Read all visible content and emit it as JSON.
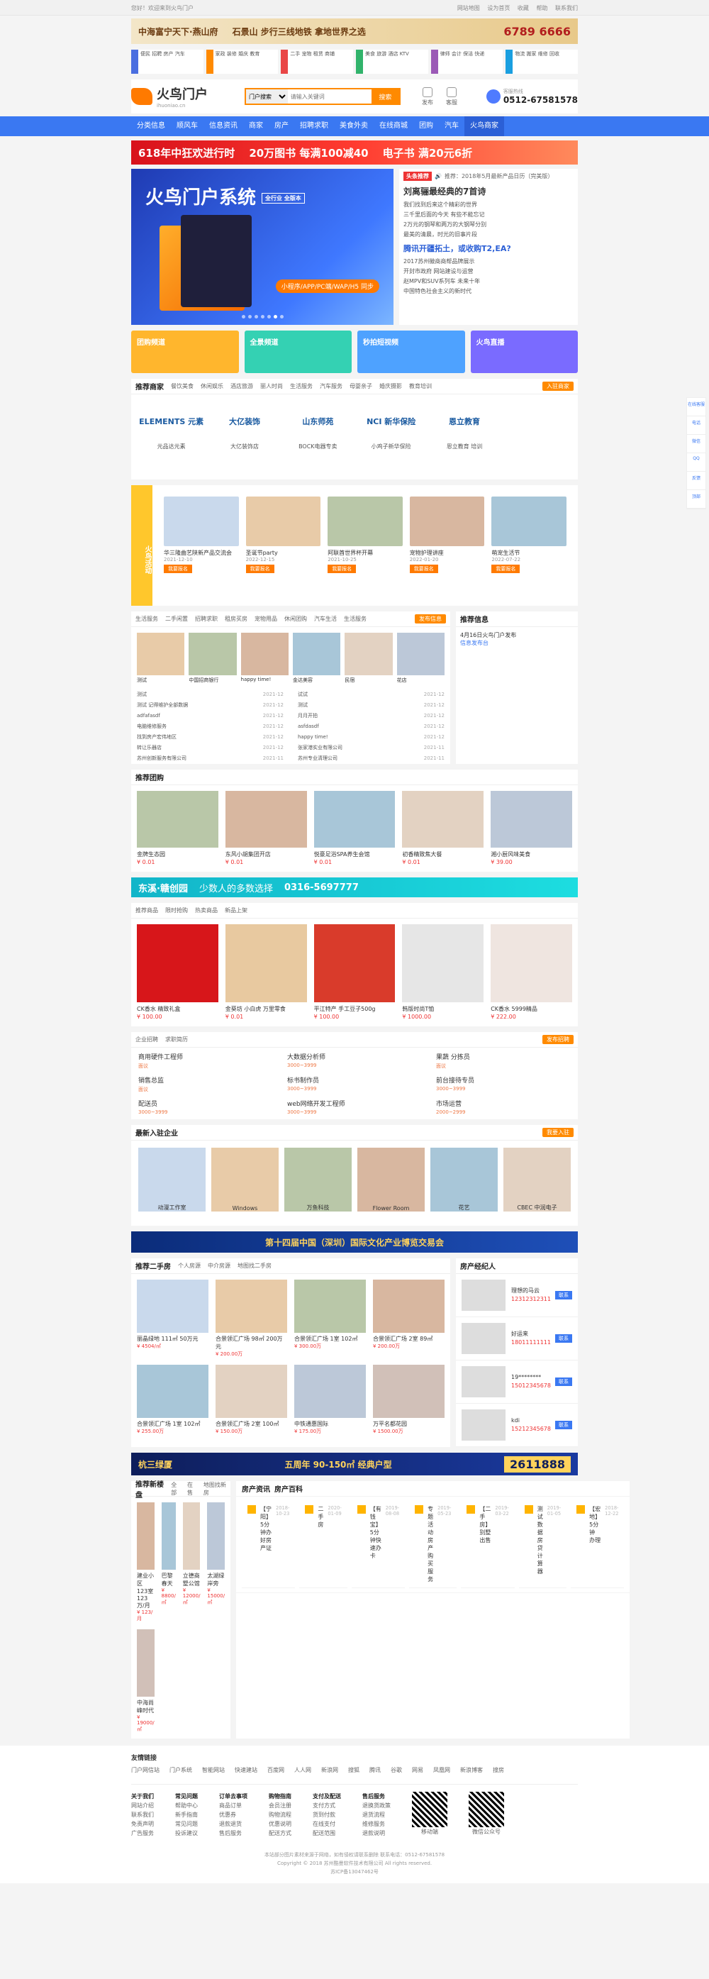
{
  "topbar": {
    "left": "您好！欢迎来到火鸟门户",
    "links": [
      "网站地图",
      "设为首页",
      "收藏",
      "帮助",
      "联系我们"
    ]
  },
  "ad_top": {
    "brand": "中海富宁天下·燕山府",
    "slogan": "石景山 步行三线地铁 拿地世界之选",
    "phone": "6789 6666"
  },
  "categories": [
    {
      "color": "#4a6ee0",
      "items": [
        "便民",
        "招聘",
        "房产",
        "汽车"
      ]
    },
    {
      "color": "#ff8a00",
      "items": [
        "家政",
        "装修",
        "婚庆",
        "教育"
      ]
    },
    {
      "color": "#e94646",
      "items": [
        "二手",
        "宠物",
        "租赁",
        "商铺"
      ]
    },
    {
      "color": "#31b36b",
      "items": [
        "美食",
        "旅游",
        "酒店",
        "KTV"
      ]
    },
    {
      "color": "#9b59b6",
      "items": [
        "律师",
        "会计",
        "保洁",
        "快递"
      ]
    },
    {
      "color": "#1a9fe0",
      "items": [
        "物流",
        "搬家",
        "维修",
        "回收"
      ]
    }
  ],
  "logo": {
    "name": "火鸟门户",
    "sub": "ihuoniao.cn"
  },
  "search": {
    "scope": "门户搜索",
    "placeholder": "请输入关键词",
    "button": "搜索"
  },
  "header_icons": [
    "发布",
    "客服"
  ],
  "hotline": {
    "label": "客服热线",
    "number": "0512-67581578"
  },
  "nav": [
    "分类信息",
    "顺风车",
    "信息资讯",
    "商家",
    "房产",
    "招聘求职",
    "美食外卖",
    "在线商城",
    "团购",
    "汽车",
    "火鸟商家"
  ],
  "ad618": {
    "left": "618年中狂欢进行时",
    "mid": "20万图书 每满100减40",
    "right": "电子书 满20元6折"
  },
  "banner": {
    "title": "火鸟门户系统",
    "tag": "全行业 全版本",
    "pill": "小程序/APP/PC端/WAP/H5 同步"
  },
  "news": {
    "badge": "头条推荐",
    "ticker": "推荐：2018年5月最新产品日历（完美版）",
    "headline": "刘离骊最经典的7首诗",
    "list1": [
      "我们找到后来这个精彩的世界",
      "三千里后面的今天 有些不能忘记",
      "2万元的钢琴和两万的大钢琴分别",
      "最美的清晨，时光的旧事片段"
    ],
    "headline2": "腾讯开疆拓土，或收购T2,EA?",
    "list2": [
      "2017苏州徽商商帮品牌展示",
      "开封市政府 网站建设与运营",
      "赵MPV和SUV系列车 未来十年",
      "中国特色社会主义的新时代"
    ]
  },
  "tiles": [
    {
      "label": "团购频道",
      "color": "#ffb62d"
    },
    {
      "label": "全景频道",
      "color": "#34d1b3"
    },
    {
      "label": "秒拍短视频",
      "color": "#4ea2ff"
    },
    {
      "label": "火鸟直播",
      "color": "#7a6bff"
    }
  ],
  "merchants": {
    "title": "推荐商家",
    "tabs": [
      "餐饮美食",
      "休闲娱乐",
      "酒店旅游",
      "丽人时尚",
      "生活服务",
      "汽车服务",
      "母婴亲子",
      "婚庆摄影",
      "教育培训"
    ],
    "more": "入驻商家",
    "items": [
      {
        "name": "ELEMENTS 元素",
        "sub": "元品达元素"
      },
      {
        "name": "大亿装饰",
        "sub": "大亿装饰店"
      },
      {
        "name": "山东师苑",
        "sub": "BOCK电器专卖"
      },
      {
        "name": "NCI 新华保险",
        "sub": "小鸡子新华保险"
      },
      {
        "name": "恩立教育",
        "sub": "恩立教育 培训"
      }
    ]
  },
  "activities": {
    "side": "火鸟活动",
    "items": [
      {
        "title": "华三隆曲艺陕新产品交流会",
        "date": "2021-12-10"
      },
      {
        "title": "圣诞节party",
        "date": "2022-12-15"
      },
      {
        "title": "阿联酋世界杯开幕",
        "date": "2021-10-25"
      },
      {
        "title": "宠物护理讲座",
        "date": "2022-01-20"
      },
      {
        "title": "萌宠生活节",
        "date": "2022-07-22"
      }
    ],
    "btn": "我要报名"
  },
  "info": {
    "tabs": [
      "生活服务",
      "二手闲置",
      "招聘求职",
      "租房买房",
      "宠物用品",
      "休闲团购",
      "汽车生活",
      "生活服务"
    ],
    "more": "发布信息",
    "pics": [
      "测试",
      "中国招商银行",
      "happy time!",
      "金达美容",
      "民宿",
      "花店"
    ],
    "list_left": [
      [
        "测试",
        "2021-12"
      ],
      [
        "测试 记得维护全部数据",
        "2021-12"
      ],
      [
        "adfafasdf",
        "2021-12"
      ],
      [
        "电脑维修服务",
        "2021-12"
      ],
      [
        "找到房产宏伟地区",
        "2021-12"
      ],
      [
        "转让乐器店",
        "2021-12"
      ],
      [
        "苏州创新服务有限公司",
        "2021-11"
      ]
    ],
    "list_right": [
      [
        "试试",
        "2021-12"
      ],
      [
        "测试",
        "2021-12"
      ],
      [
        "月月开拍",
        "2021-12"
      ],
      [
        "asfdasdf",
        "2021-12"
      ],
      [
        "happy time!",
        "2021-12"
      ],
      [
        "张家港实业有限公司",
        "2021-11"
      ],
      [
        "苏州专业清理公司",
        "2021-11"
      ]
    ]
  },
  "rec_news": {
    "title": "推荐信息",
    "item": "4月16日火鸟门户发布",
    "sub": "信息发布台"
  },
  "group": {
    "title": "推荐团购",
    "items": [
      {
        "name": "金牌生态园",
        "price": "¥ 0.01"
      },
      {
        "name": "东风小胡集团开店",
        "price": "¥ 0.01"
      },
      {
        "name": "悦豪足浴SPA养生会馆",
        "price": "¥ 0.01"
      },
      {
        "name": "初香精致焦大餐",
        "price": "¥ 0.01"
      },
      {
        "name": "湘小厨风味美食",
        "price": "¥ 39.00"
      }
    ]
  },
  "ad2": {
    "brand": "东溪·赣创园",
    "slogan": "少数人的多数选择",
    "phone": "0316-5697777"
  },
  "mall": {
    "tabs": [
      "推荐商品",
      "限时抢购",
      "热卖商品",
      "新品上架"
    ],
    "items": [
      {
        "name": "CK香水 精致礼盒",
        "price": "¥ 100.00"
      },
      {
        "name": "金葵坊 小白虎 万里零食",
        "price": "¥ 0.01"
      },
      {
        "name": "平江特产 手工豆子500g",
        "price": "¥ 100.00"
      },
      {
        "name": "韩版时尚T恤",
        "price": "¥ 1000.00"
      },
      {
        "name": "CK香水 5999精品",
        "price": "¥ 222.00"
      }
    ]
  },
  "jobs": {
    "tabs": [
      "企业招聘",
      "求职简历"
    ],
    "more": "发布招聘",
    "items": [
      {
        "title": "商用硬件工程师",
        "pay": "面议"
      },
      {
        "title": "大数据分析师",
        "pay": "3000~3999"
      },
      {
        "title": "果蔬 分拣员",
        "pay": "面议"
      },
      {
        "title": "销售总监",
        "pay": "面议"
      },
      {
        "title": "标书制作员",
        "pay": "3000~3999"
      },
      {
        "title": "前台接待专员",
        "pay": "3000~3999"
      },
      {
        "title": "配送员",
        "pay": "3000~3999"
      },
      {
        "title": "web网络开发工程师",
        "pay": "3000~3999"
      },
      {
        "title": "市场运营",
        "pay": "2000~2999"
      }
    ]
  },
  "newcos": {
    "title": "最新入驻企业",
    "more": "我要入驻",
    "items": [
      "动漫工作室",
      "Windows",
      "万鱼科技",
      "Flower Room",
      "花艺",
      "CBEC 中润电子"
    ]
  },
  "ad3": {
    "text": "第十四届中国（深圳）国际文化产业博览交易会"
  },
  "house": {
    "title": "推荐二手房",
    "tabs": [
      "个人房源",
      "中介房源",
      "地图找二手房"
    ],
    "items": [
      {
        "name": "丽晶绿地 111㎡ 50万元",
        "price": "¥ 4504/㎡"
      },
      {
        "name": "合景领汇广场 98㎡ 200万元",
        "price": "¥ 200.00万"
      },
      {
        "name": "合景领汇广场 1室 102㎡",
        "price": "¥ 300.00万"
      },
      {
        "name": "合景领汇广场 2室 89㎡",
        "price": "¥ 200.00万"
      },
      {
        "name": "合景领汇广场 1室 102㎡",
        "price": "¥ 255.00万"
      },
      {
        "name": "合景领汇广场 2室 100㎡",
        "price": "¥ 150.00万"
      },
      {
        "name": "中铁通惠国际",
        "price": "¥ 175.00万"
      },
      {
        "name": "万平名都花园",
        "price": "¥ 1500.00万"
      }
    ]
  },
  "agents": {
    "title": "房产经纪人",
    "items": [
      {
        "name": "理想的马云",
        "tel": "12312312311"
      },
      {
        "name": "好运来",
        "tel": "18011111111"
      },
      {
        "name": "19********",
        "tel": "15012345678"
      },
      {
        "name": "kdi",
        "tel": "15212345678"
      }
    ],
    "btn": "联系"
  },
  "ad4": {
    "brand": "杭三绿厦",
    "text": "五周年 90-150㎡ 经典户型",
    "phone": "2611888"
  },
  "newhouse": {
    "title": "推荐新楼盘",
    "tabs": [
      "全部",
      "在售",
      "地图找新房"
    ],
    "items": [
      {
        "name": "建业小区 123室 123万/月",
        "price": "¥ 123/月"
      },
      {
        "name": "巴黎春天",
        "price": "¥ 8800/㎡"
      },
      {
        "name": "立德商墅公馆",
        "price": "¥ 12000/㎡"
      },
      {
        "name": "太湖绿岸旁",
        "price": "¥ 15000/㎡"
      },
      {
        "name": "中海尚峰时代",
        "price": "¥ 19000/㎡"
      }
    ]
  },
  "qa": {
    "tabs": [
      "房产资讯",
      "房产百科"
    ],
    "items": [
      {
        "t": "【宁阳】5分钟办好房产证",
        "d": "2018-10-23"
      },
      {
        "t": "二手房",
        "d": "2020-01-09"
      },
      {
        "t": "【有钱宝】5分钟快速办卡",
        "d": "2019-08-08"
      },
      {
        "t": "专题活动 房产购买服务",
        "d": "2019-05-23"
      },
      {
        "t": "【二手房】别墅出售",
        "d": "2019-03-22"
      },
      {
        "t": "测试数据 房贷计算器",
        "d": "2019-01-05"
      },
      {
        "t": "【宏地】5分钟 办理",
        "d": "2018-12-22"
      }
    ]
  },
  "footer": {
    "friend_title": "友情链接",
    "friend_links": [
      "门户网信站",
      "门户系统",
      "智能网站",
      "快速建站",
      "百度网",
      "人人网",
      "新浪网",
      "搜狐",
      "腾讯",
      "谷歌",
      "网易",
      "凤凰网",
      "新浪博客",
      "搜房"
    ],
    "cols": [
      {
        "h": "关于我们",
        "items": [
          "网站介绍",
          "联系我们",
          "免责声明",
          "广告服务"
        ]
      },
      {
        "h": "常见问题",
        "items": [
          "帮助中心",
          "新手指南",
          "常见问题",
          "投诉建议"
        ]
      },
      {
        "h": "订单去事项",
        "items": [
          "商品订单",
          "优惠券",
          "退款退货",
          "售后服务"
        ]
      },
      {
        "h": "购物指南",
        "items": [
          "会员注册",
          "购物流程",
          "优惠说明",
          "配送方式"
        ]
      },
      {
        "h": "支付及配送",
        "items": [
          "支付方式",
          "货到付款",
          "在线支付",
          "配送范围"
        ]
      },
      {
        "h": "售后服务",
        "items": [
          "退换货政策",
          "退货流程",
          "维修服务",
          "退款说明"
        ]
      }
    ],
    "qr1": "移动端",
    "qr2": "微信公众号",
    "copyright": [
      "本站部分图片素材来源于网络，如有侵权请联系删除 联系电话：0512-67581578",
      "Copyright © 2018 苏州酷曼软件技术有限公司 All rights reserved.",
      "苏ICP备13047462号"
    ]
  },
  "float": [
    "在线客服",
    "电话",
    "微信",
    "QQ",
    "反馈",
    "顶部"
  ]
}
